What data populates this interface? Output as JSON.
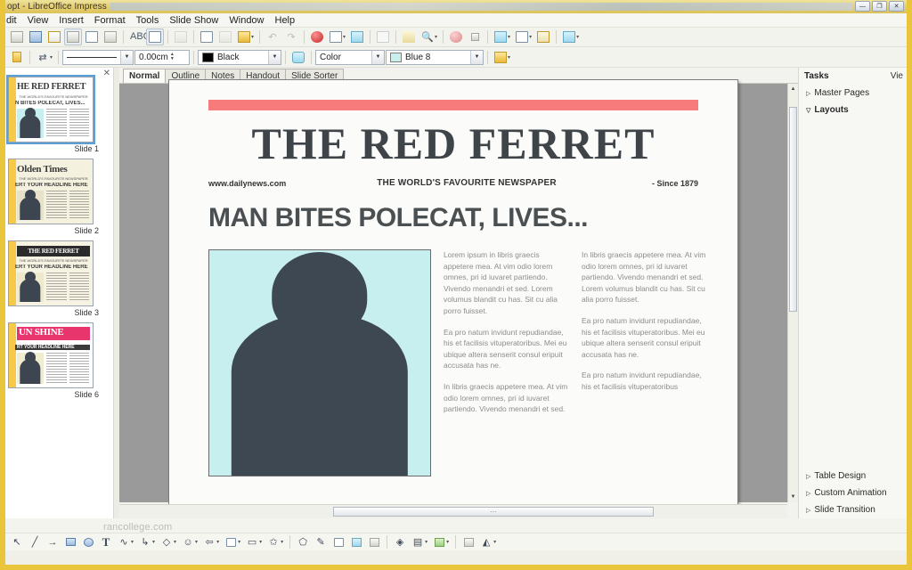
{
  "window": {
    "title": "opt - LibreOffice Impress",
    "buttons": {
      "minimize": "—",
      "maximize": "❐",
      "close": "✕"
    }
  },
  "menubar": {
    "items": [
      "dit",
      "View",
      "Insert",
      "Format",
      "Tools",
      "Slide Show",
      "Window",
      "Help"
    ]
  },
  "toolbar_standard": {
    "icons": [
      "new-icon",
      "save-icon",
      "open-icon",
      "edit-file-icon",
      "export-pdf-icon",
      "print-icon",
      "spelling-icon",
      "autospellcheck-icon",
      "cut-icon",
      "copy-icon",
      "paste-icon",
      "clone-formatting-icon",
      "undo-icon",
      "redo-icon",
      "chart-icon",
      "table-icon",
      "image-icon",
      "grid-icon",
      "zoom-icon",
      "display-views-icon",
      "master-slide-icon",
      "start-slideshow-icon",
      "hyperlink-icon",
      "draw-functions-icon",
      "show-draw-icon"
    ]
  },
  "toolbar_lineandfill": {
    "line_style_value": "",
    "line_width_value": "0.00cm",
    "line_color_value": "Black",
    "fill_style_value": "Color",
    "fill_color_value": "Blue 8",
    "icons": [
      "line-style-icon",
      "arrow-style-icon",
      "shadow-icon",
      "area-style-icon"
    ]
  },
  "view_tabs": {
    "items": [
      "Normal",
      "Outline",
      "Notes",
      "Handout",
      "Slide Sorter"
    ],
    "active": "Normal"
  },
  "slide_panel": {
    "close_label": "✕",
    "slides": [
      {
        "label": "Slide 1",
        "title": "HE RED FERRET",
        "headline": "N BITES POLECAT, LIVES...",
        "sub": "THE WORLD'S FAVOURITE NEWSPAPER",
        "bar_color": "#f7c948",
        "paper_color": "#ffffff",
        "title_color": "#3c3c3c",
        "photo_color": "#c8eff0",
        "selected": true
      },
      {
        "label": "Slide 2",
        "title": "Olden Times",
        "headline": "ERT YOUR HEADLINE HERE",
        "sub": "THE WORLD'S FAVOURITE NEWSPAPER",
        "bar_color": "#f7c948",
        "paper_color": "#f4f1de",
        "title_color": "#2c2c2c",
        "photo_color": "#e8e3c8",
        "selected": false
      },
      {
        "label": "Slide 3",
        "title": "THE RED FERRET",
        "headline": "ERT YOUR HEADLINE HERE",
        "sub": "THE WORLD'S FAVOURITE NEWSPAPER",
        "bar_color": "#f7c948",
        "paper_color": "#f6f3e2",
        "title_color": "#222222",
        "photo_color": "#efe9cc",
        "selected": false
      },
      {
        "label": "Slide 6",
        "title": "UN SHINE",
        "headline": "RT YOUR HEADLINE HERE",
        "sub": "THE WORLD'S FAVOURITE NEWSPAPER",
        "bar_color": "#f7c948",
        "paper_color": "#ffffff",
        "title_color": "#ffffff",
        "photo_color": "#efeccf",
        "selected": false
      }
    ]
  },
  "slide": {
    "accent_bar_color": "#f77b7b",
    "masthead": "THE RED FERRET",
    "website": "www.dailynews.com",
    "tagline": "THE WORLD'S FAVOURITE NEWSPAPER",
    "since": "- Since 1879",
    "headline": "MAN BITES POLECAT, LIVES...",
    "photo_bg_color": "#c8eff0",
    "column_left": [
      "Lorem ipsum in libris graecis appetere mea. At vim odio lorem omnes, pri id iuvaret partiendo. Vivendo menandri et sed. Lorem volumus blandit cu has. Sit cu alia porro fuisset.",
      "Ea pro natum invidunt repudiandae, his et facilisis vituperatoribus. Mei eu ubique altera senserit consul eripuit accusata has ne.",
      "In libris graecis appetere mea. At vim odio lorem omnes, pri id iuvaret partiendo. Vivendo menandri et sed."
    ],
    "column_right": [
      "In libris graecis appetere mea. At vim odio lorem omnes, pri id iuvaret partiendo. Vivendo menandri et sed. Lorem volumus blandit cu has. Sit cu alia porro fuisset.",
      "Ea pro natum invidunt repudiandae, his et facilisis vituperatoribus. Mei eu ubique altera senserit consul eripuit accusata has ne.",
      "Ea pro natum invidunt repudiandae, his et facilisis vituperatoribus"
    ]
  },
  "tasks": {
    "header": "Tasks",
    "view_label": "Vie",
    "items": [
      {
        "label": "Master Pages",
        "expanded": false,
        "bold": false
      },
      {
        "label": "Layouts",
        "expanded": true,
        "bold": true
      },
      {
        "label": "Table Design",
        "expanded": false,
        "bold": false
      },
      {
        "label": "Custom Animation",
        "expanded": false,
        "bold": false
      },
      {
        "label": "Slide Transition",
        "expanded": false,
        "bold": false
      }
    ]
  },
  "drawing_toolbar": {
    "icons": [
      "select-icon",
      "line-icon",
      "rectangle-icon",
      "ellipse-icon",
      "text-icon",
      "curve-icon",
      "connector-icon",
      "basic-shapes-icon",
      "symbol-shapes-icon",
      "block-arrows-icon",
      "flowchart-icon",
      "callouts-icon",
      "stars-icon",
      "points-icon",
      "glue-points-icon",
      "fontwork-icon",
      "from-file-icon",
      "gallery-icon",
      "rotate-icon",
      "alignment-icon",
      "arrange-icon",
      "shadow-icon",
      "crop-icon",
      "filter-icon"
    ]
  },
  "watermark": "rancollege.com"
}
